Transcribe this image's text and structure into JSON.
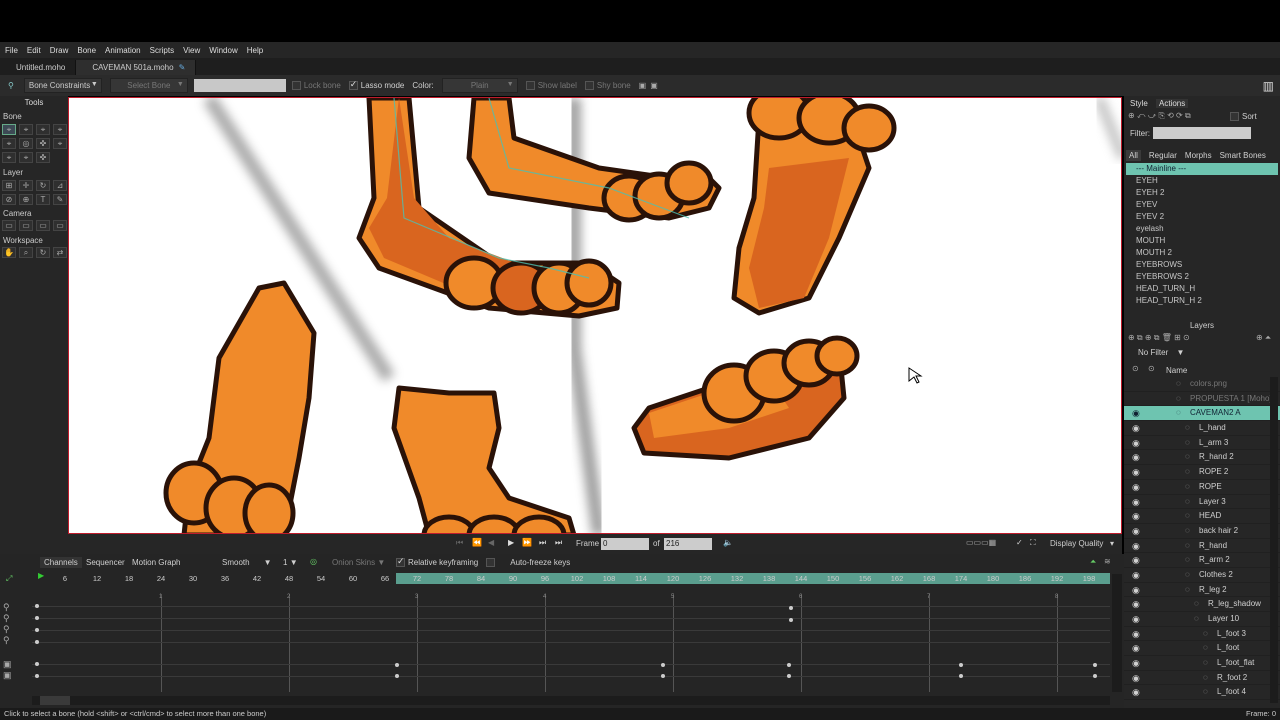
{
  "menu": [
    "File",
    "Edit",
    "Draw",
    "Bone",
    "Animation",
    "Scripts",
    "View",
    "Window",
    "Help"
  ],
  "tabs": [
    {
      "label": "Untitled.moho"
    },
    {
      "label": "CAVEMAN 501a.moho"
    }
  ],
  "options": {
    "constraints": "Bone Constraints",
    "select_bone": "Select Bone",
    "lock_bone": "Lock bone",
    "lasso_mode": "Lasso mode",
    "color_label": "Color:",
    "color_value": "Plain",
    "show_label": "Show label",
    "shy_bone": "Shy bone"
  },
  "tools": {
    "title": "Tools",
    "sections": [
      "Bone",
      "Layer",
      "Camera",
      "Workspace"
    ]
  },
  "transport": {
    "frame_label": "Frame",
    "frame_value": "0",
    "of_label": "of",
    "total": "216",
    "display_quality": "Display Quality"
  },
  "timeline": {
    "tabs": [
      "Channels",
      "Sequencer",
      "Motion Graph"
    ],
    "interp": "Smooth",
    "interp_num": "1",
    "onion": "Onion Skins",
    "relative": "Relative keyframing",
    "autofreeze": "Auto-freeze keys",
    "ruler": [
      "0",
      "6",
      "12",
      "18",
      "24",
      "30",
      "36",
      "42",
      "48",
      "54",
      "60",
      "66",
      "72",
      "78",
      "84",
      "90",
      "96",
      "102",
      "108",
      "114",
      "120",
      "126",
      "132",
      "138",
      "144",
      "150",
      "156",
      "162",
      "168",
      "174",
      "180",
      "186",
      "192",
      "198"
    ],
    "seconds": [
      "1",
      "2",
      "3",
      "4",
      "5",
      "6",
      "7",
      "8"
    ]
  },
  "right": {
    "tabs": [
      "Style",
      "Actions"
    ],
    "sort": "Sort",
    "filter_label": "Filter:",
    "filter_tabs": [
      "All",
      "Regular",
      "Morphs",
      "Smart Bones"
    ],
    "actions": [
      "--- Mainline ---",
      "EYEH",
      "EYEH 2",
      "EYEV",
      "EYEV 2",
      "eyelash",
      "MOUTH",
      "MOUTH 2",
      "EYEBROWS",
      "EYEBROWS 2",
      "HEAD_TURN_H",
      "HEAD_TURN_H 2"
    ],
    "layers_title": "Layers",
    "layer_filter": "No Filter",
    "name_col": "Name",
    "layers": [
      {
        "name": "colors.png",
        "indent": 0
      },
      {
        "name": "PROPUESTA 1 [Moho]",
        "indent": 0
      },
      {
        "name": "CAVEMAN2 A",
        "indent": 0
      },
      {
        "name": "L_hand",
        "indent": 1
      },
      {
        "name": "L_arm 3",
        "indent": 1
      },
      {
        "name": "R_hand 2",
        "indent": 1
      },
      {
        "name": "ROPE 2",
        "indent": 1
      },
      {
        "name": "ROPE",
        "indent": 1
      },
      {
        "name": "Layer 3",
        "indent": 1
      },
      {
        "name": "HEAD",
        "indent": 1
      },
      {
        "name": "back hair 2",
        "indent": 1
      },
      {
        "name": "R_hand",
        "indent": 1
      },
      {
        "name": "R_arm 2",
        "indent": 1
      },
      {
        "name": "Clothes 2",
        "indent": 1
      },
      {
        "name": "R_leg 2",
        "indent": 1
      },
      {
        "name": "R_leg_shadow",
        "indent": 2
      },
      {
        "name": "Layer 10",
        "indent": 2
      },
      {
        "name": "L_foot 3",
        "indent": 3
      },
      {
        "name": "L_foot",
        "indent": 3
      },
      {
        "name": "L_foot_flat",
        "indent": 3
      },
      {
        "name": "R_foot 2",
        "indent": 3
      },
      {
        "name": "L_foot 4",
        "indent": 3
      }
    ]
  },
  "status": {
    "hint": "Click to select a bone (hold <shift> or <ctrl/cmd> to select more than one bone)",
    "frame": "Frame: 0"
  },
  "colors": {
    "accent": "#6ec4b0",
    "selection_border": "#c01c2c",
    "orange": "#f08a2a",
    "dark_orange": "#d9651f",
    "outline": "#2a1208"
  }
}
